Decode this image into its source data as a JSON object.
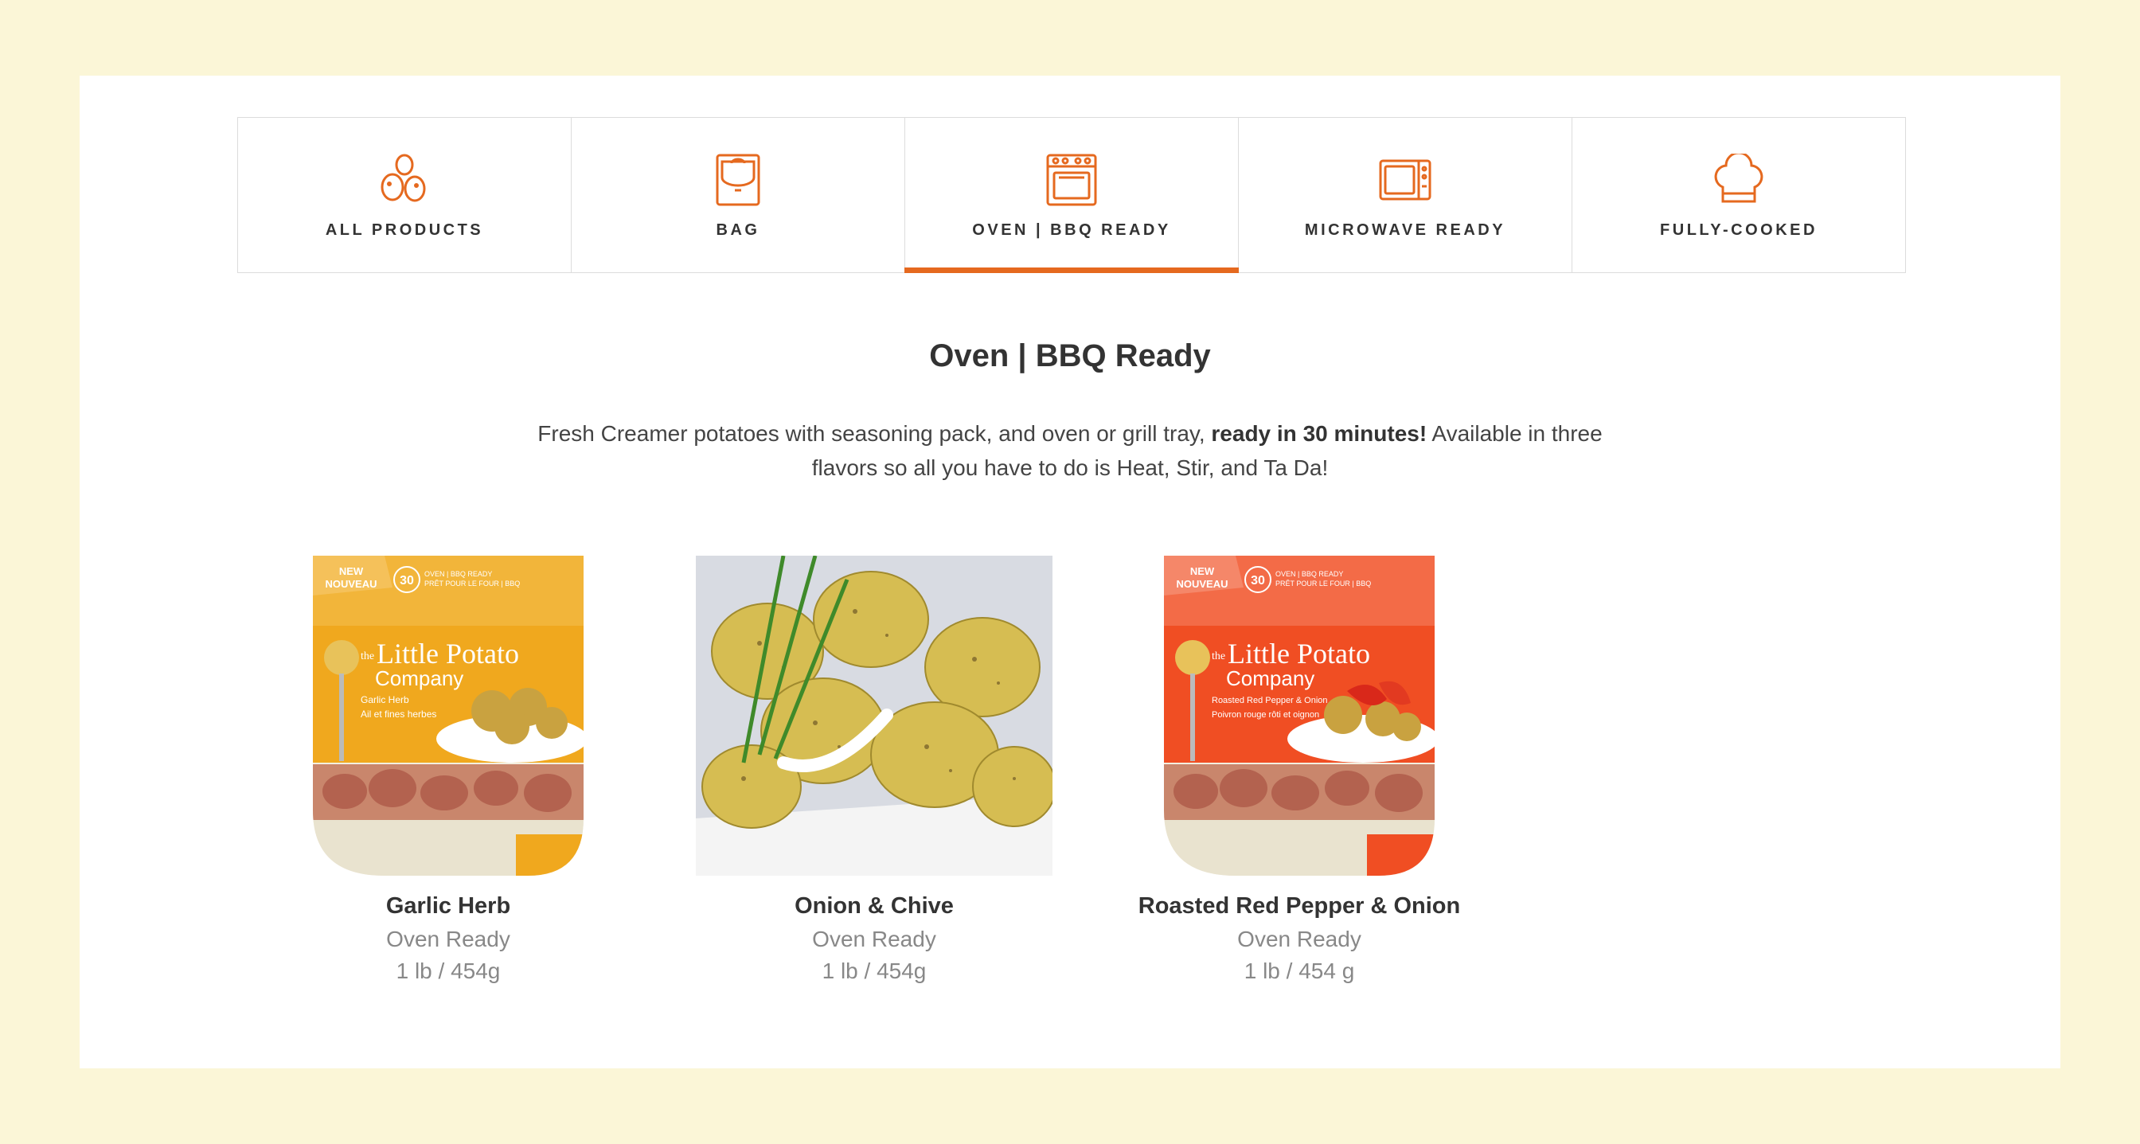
{
  "tabs": [
    {
      "label": "ALL PRODUCTS",
      "icon": "potatoes-icon",
      "active": false
    },
    {
      "label": "BAG",
      "icon": "bag-icon",
      "active": false
    },
    {
      "label": "OVEN | BBQ READY",
      "icon": "oven-icon",
      "active": true
    },
    {
      "label": "MICROWAVE READY",
      "icon": "microwave-icon",
      "active": false
    },
    {
      "label": "FULLY-COOKED",
      "icon": "chef-hat-icon",
      "active": false
    }
  ],
  "section": {
    "title": "Oven | BBQ Ready",
    "description_pre": "Fresh Creamer potatoes with seasoning pack, and oven or grill tray, ",
    "description_bold": "ready in 30 minutes!",
    "description_post": " Available in three flavors so all you have to do is Heat, Stir, and Ta Da!"
  },
  "products": [
    {
      "name": "Garlic Herb",
      "type": "Oven Ready",
      "size": "1 lb / 454g",
      "package": {
        "badge": "NEW NOUVEAU",
        "top_line": "OVEN | BBQ READY",
        "top_line_fr": "PRÊT POUR LE FOUR | BBQ",
        "brand_small": "the",
        "brand_1": "Little Potato",
        "brand_2": "Company",
        "flavor": "Garlic Herb",
        "flavor_fr": "Ail et fines herbes",
        "minutes": "30"
      }
    },
    {
      "name": "Onion & Chive",
      "type": "Oven Ready",
      "size": "1 lb / 454g"
    },
    {
      "name": "Roasted Red Pepper & Onion",
      "type": "Oven Ready",
      "size": "1 lb / 454 g",
      "package": {
        "badge": "NEW NOUVEAU",
        "top_line": "OVEN | BBQ READY",
        "top_line_fr": "PRÊT POUR LE FOUR | BBQ",
        "brand_small": "the",
        "brand_1": "Little Potato",
        "brand_2": "Company",
        "flavor": "Roasted Red Pepper & Onion",
        "flavor_fr": "Poivron rouge rôti et oignon",
        "minutes": "30"
      }
    }
  ],
  "colors": {
    "background": "#fbf6d7",
    "accent": "#e5691f",
    "garlic_tray": "#f0a81e",
    "pepper_tray": "#f04e23"
  }
}
